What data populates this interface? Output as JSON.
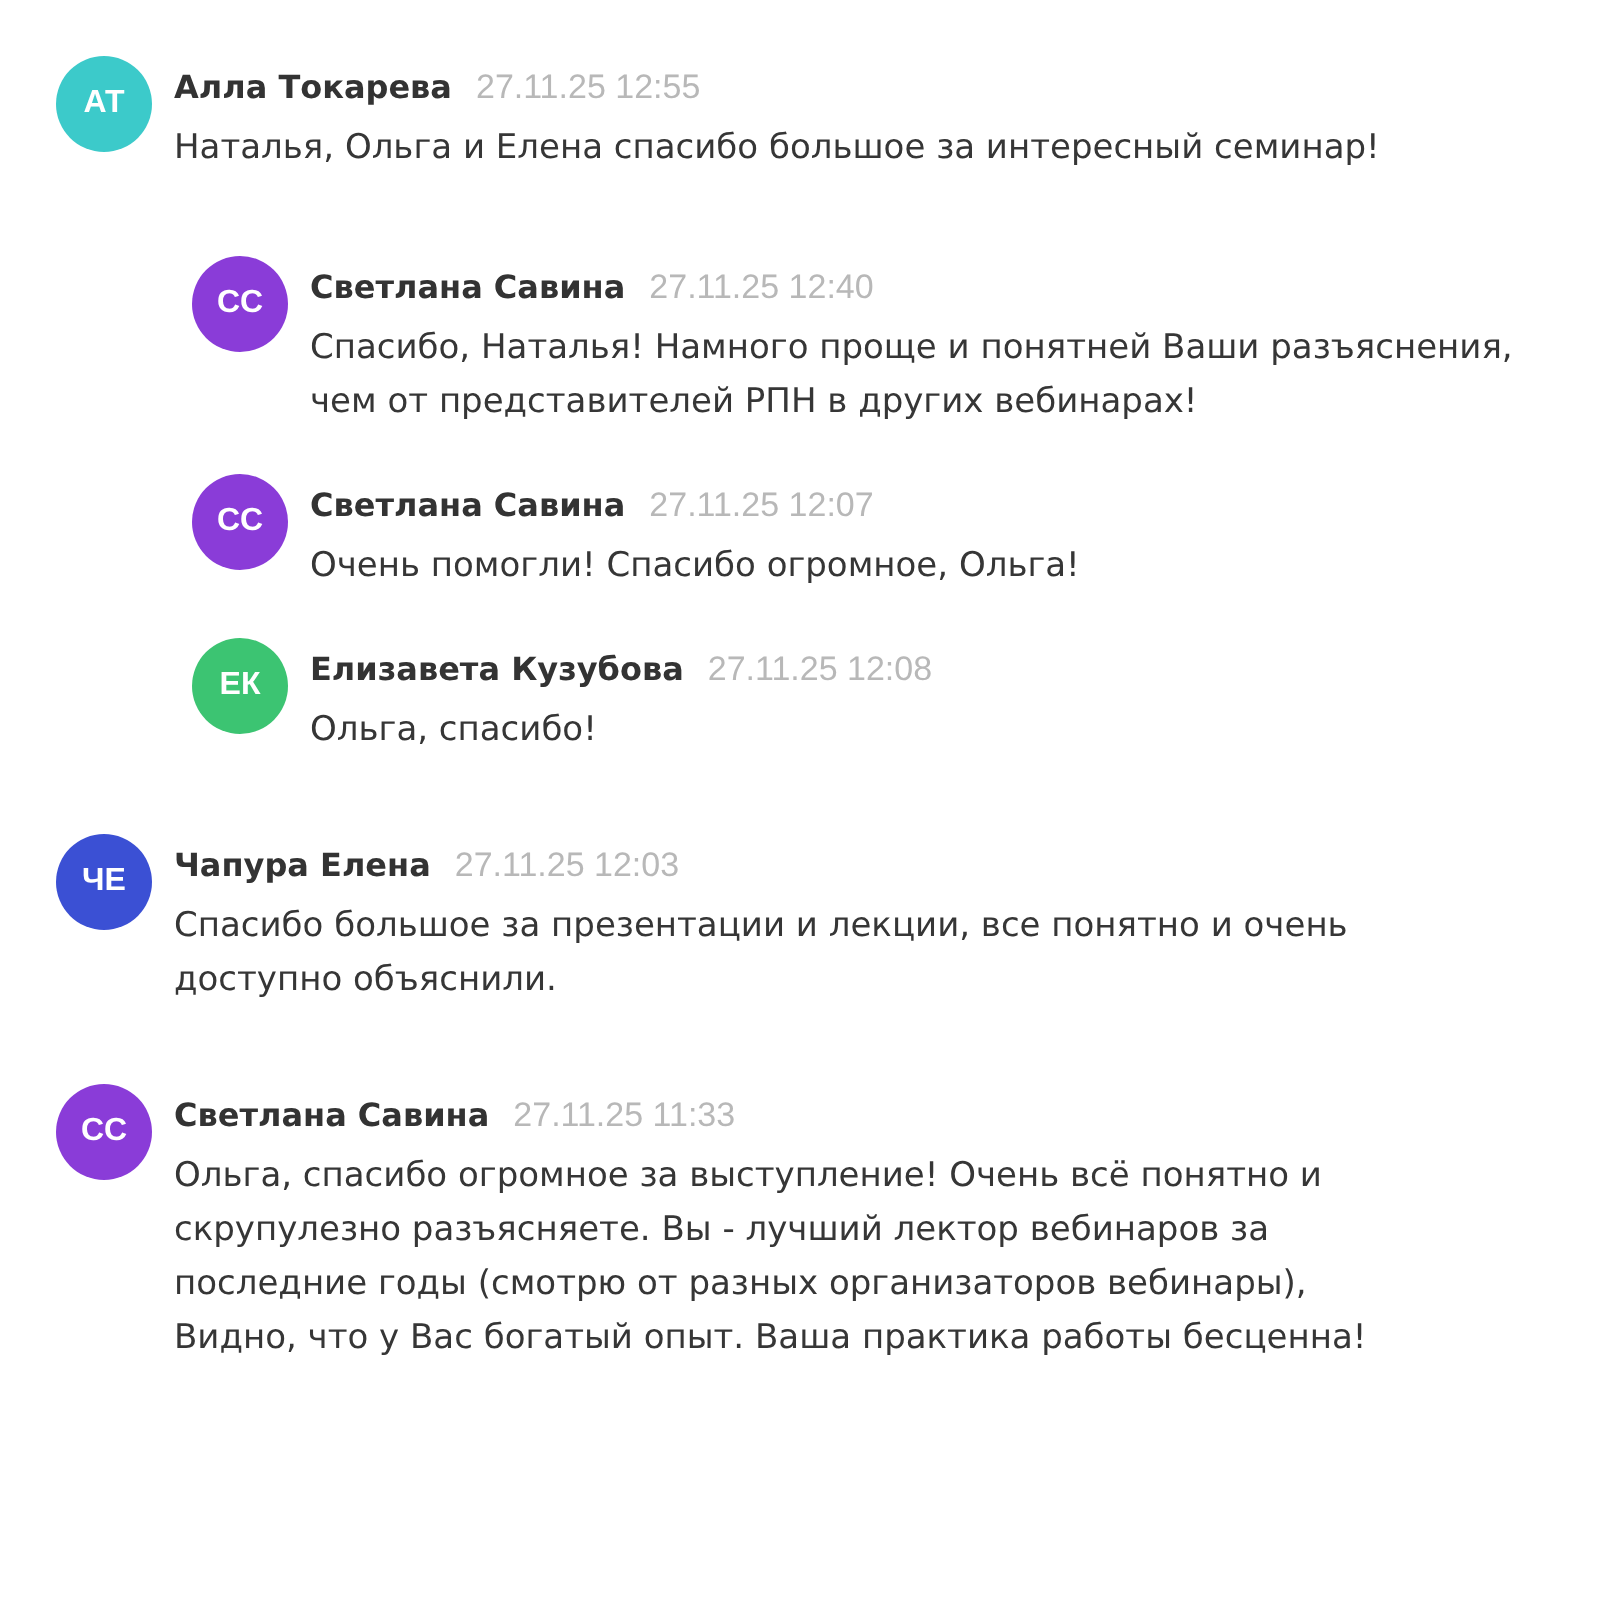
{
  "comments": [
    {
      "initials": "АТ",
      "color": "#3ccaca",
      "author": "Алла Токарева",
      "time": "27.11.25 12:55",
      "text": "Наталья, Ольга и Елена спасибо большое за интересный семинар!",
      "children": [
        {
          "initials": "СС",
          "color": "#8a3cd8",
          "author": "Светлана Савина",
          "time": "27.11.25 12:40",
          "text": "Спасибо, Наталья! Намного проще и понятней Ваши разъяснения, чем от представителей РПН в других вебинарах!"
        },
        {
          "initials": "СС",
          "color": "#8a3cd8",
          "author": "Светлана Савина",
          "time": "27.11.25 12:07",
          "text": "Очень помогли! Спасибо огромное, Ольга!"
        },
        {
          "initials": "ЕК",
          "color": "#3cc472",
          "author": "Елизавета Кузубова",
          "time": "27.11.25 12:08",
          "text": "Ольга, спасибо!"
        }
      ]
    },
    {
      "initials": "ЧЕ",
      "color": "#3b50d4",
      "author": "Чапура Елена",
      "time": "27.11.25 12:03",
      "text": "Спасибо большое за презентации и лекции, все понятно и очень доступно объяснили."
    },
    {
      "initials": "СС",
      "color": "#8a3cd8",
      "author": "Светлана Савина",
      "time": "27.11.25 11:33",
      "text": "Ольга, спасибо огромное за выступление! Очень всё понятно и скрупулезно разъясняете. Вы - лучший лектор вебинаров за последние годы (смотрю от разных организаторов вебинары), Видно, что у Вас богатый опыт. Ваша практика работы бесценна!"
    }
  ]
}
